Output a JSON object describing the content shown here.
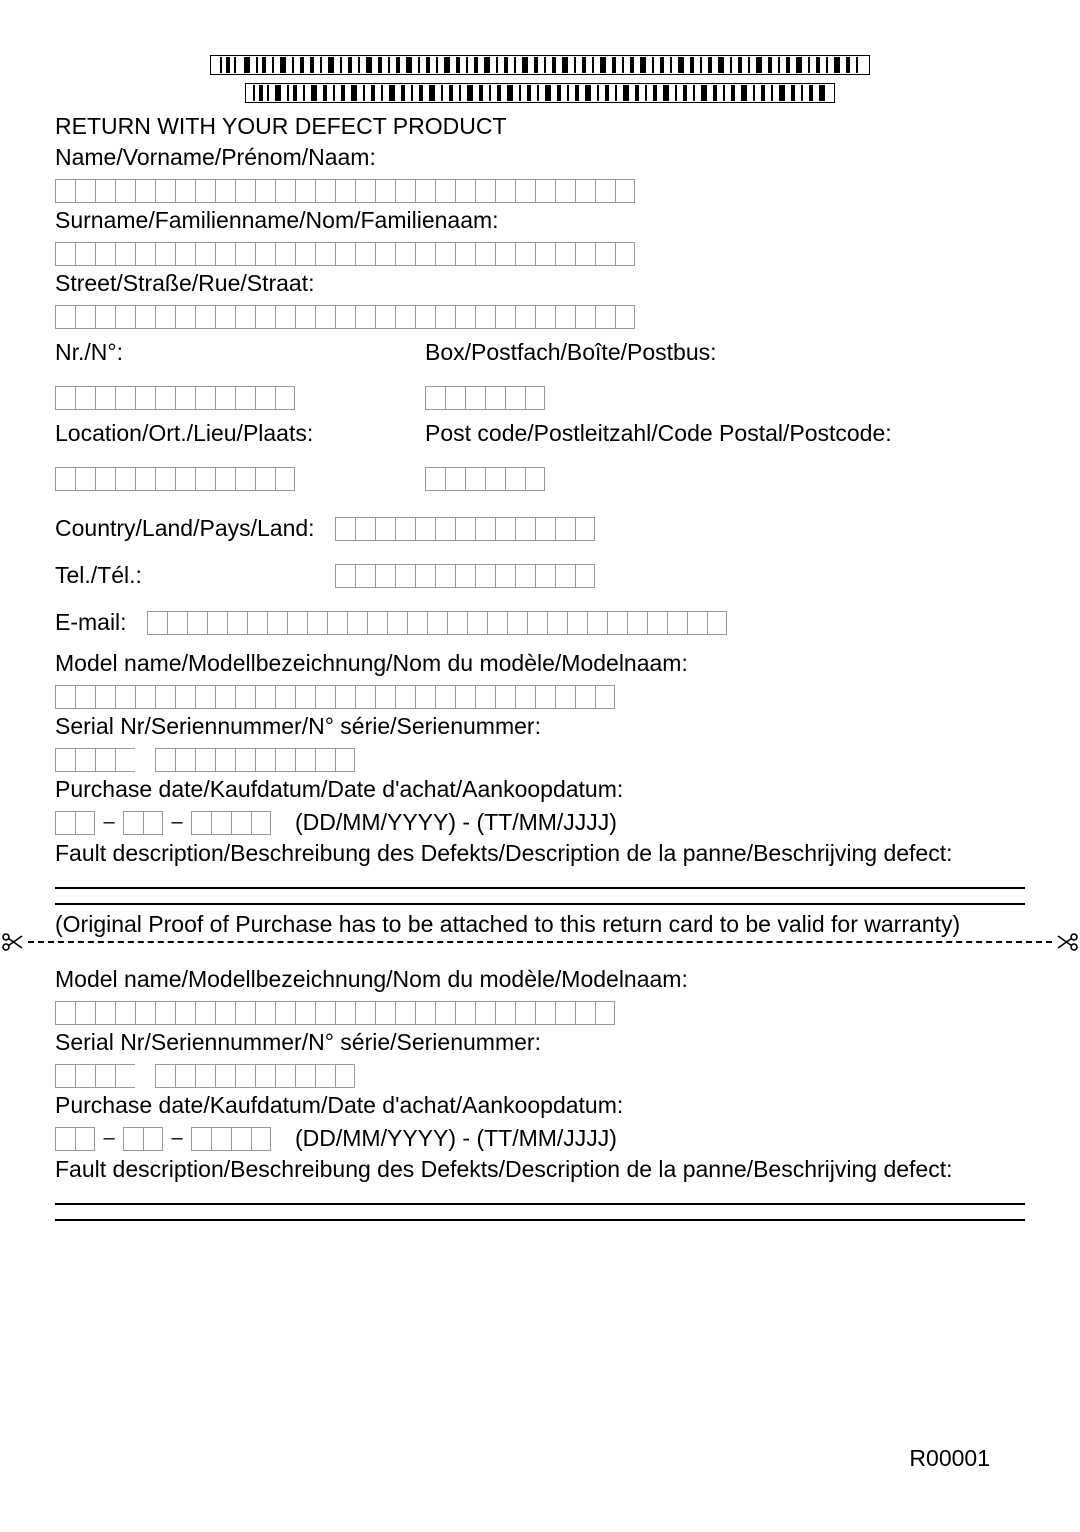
{
  "title": "RETURN WITH YOUR DEFECT PRODUCT",
  "labels": {
    "name": "Name/Vorname/Prénom/Naam:",
    "surname": "Surname/Familienname/Nom/Familienaam:",
    "street": "Street/Straße/Rue/Straat:",
    "nr": "Nr./N°:",
    "box": "Box/Postfach/Boîte/Postbus:",
    "location": "Location/Ort./Lieu/Plaats:",
    "postcode": "Post code/Postleitzahl/Code Postal/Postcode:",
    "country": "Country/Land/Pays/Land:",
    "tel": "Tel./Tél.:",
    "email": "E-mail:",
    "model": "Model name/Modellbezeichnung/Nom du modèle/Modelnaam:",
    "serial": "Serial Nr/Seriennummer/N° série/Serienummer:",
    "purchase": "Purchase date/Kaufdatum/Date d'achat/Aankoopdatum:",
    "date_hint": "(DD/MM/YYYY) - (TT/MM/JJJJ)",
    "fault": "Fault description/Beschreibung des Defekts/Description de la panne/Beschrijving defect:",
    "proof": "(Original Proof of Purchase has to be attached to this return card to be valid for warranty)"
  },
  "box_counts": {
    "name": 29,
    "surname": 29,
    "street": 29,
    "nr": 12,
    "box": 6,
    "location": 12,
    "postcode": 6,
    "country": 13,
    "tel": 13,
    "email": 29,
    "model": 28,
    "serial_group1": 4,
    "serial_group2": 10,
    "date_dd": 2,
    "date_mm": 2,
    "date_yyyy": 4
  },
  "footer": "R00001"
}
